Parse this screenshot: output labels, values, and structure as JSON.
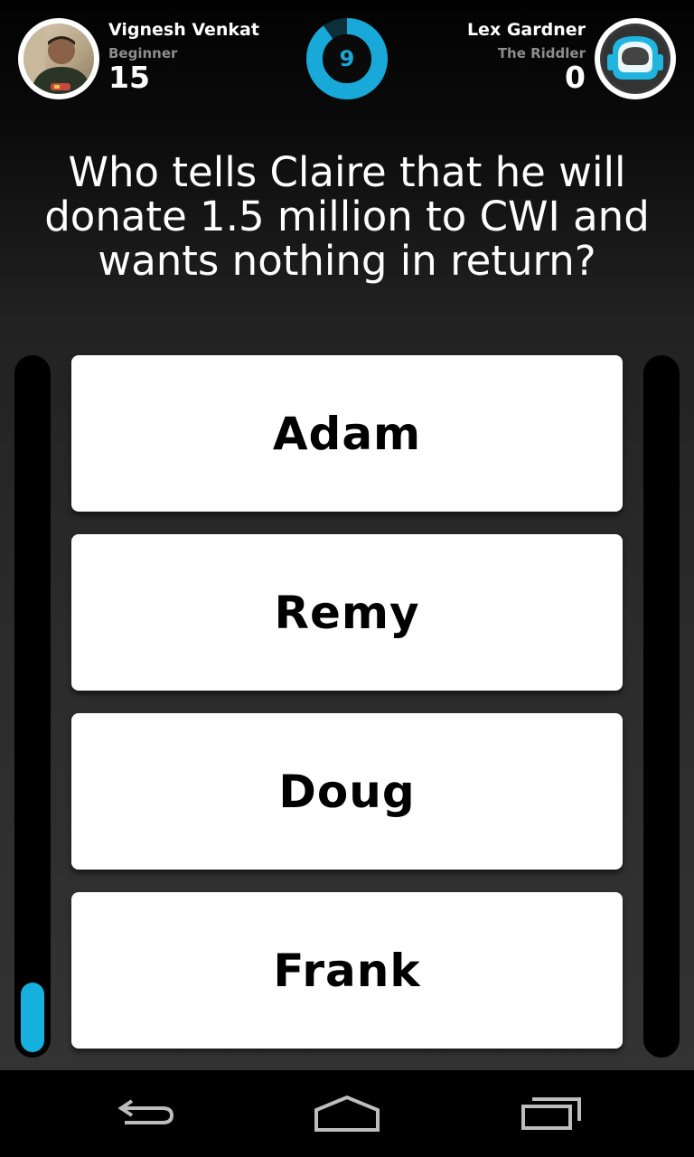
{
  "player_left": {
    "name": "Vignesh Venkat",
    "rank": "Beginner",
    "score": "15"
  },
  "player_right": {
    "name": "Lex Gardner",
    "rank": "The Riddler",
    "score": "0"
  },
  "timer": {
    "value": "9",
    "fraction_remaining": 0.9
  },
  "question": {
    "text": "Who tells Claire that he will donate 1.5 million to CWI and wants nothing in return?"
  },
  "answers": [
    {
      "label": "Adam"
    },
    {
      "label": "Remy"
    },
    {
      "label": "Doug"
    },
    {
      "label": "Frank"
    }
  ],
  "progress": {
    "left_fraction": 0.1,
    "right_fraction": 0.0
  },
  "navbar": {
    "back_icon": "back-icon",
    "home_icon": "home-icon",
    "recents_icon": "recent-apps-icon"
  },
  "colors": {
    "accent": "#18a9d8",
    "track_fill": "#15b0dd",
    "background": "#222222"
  }
}
